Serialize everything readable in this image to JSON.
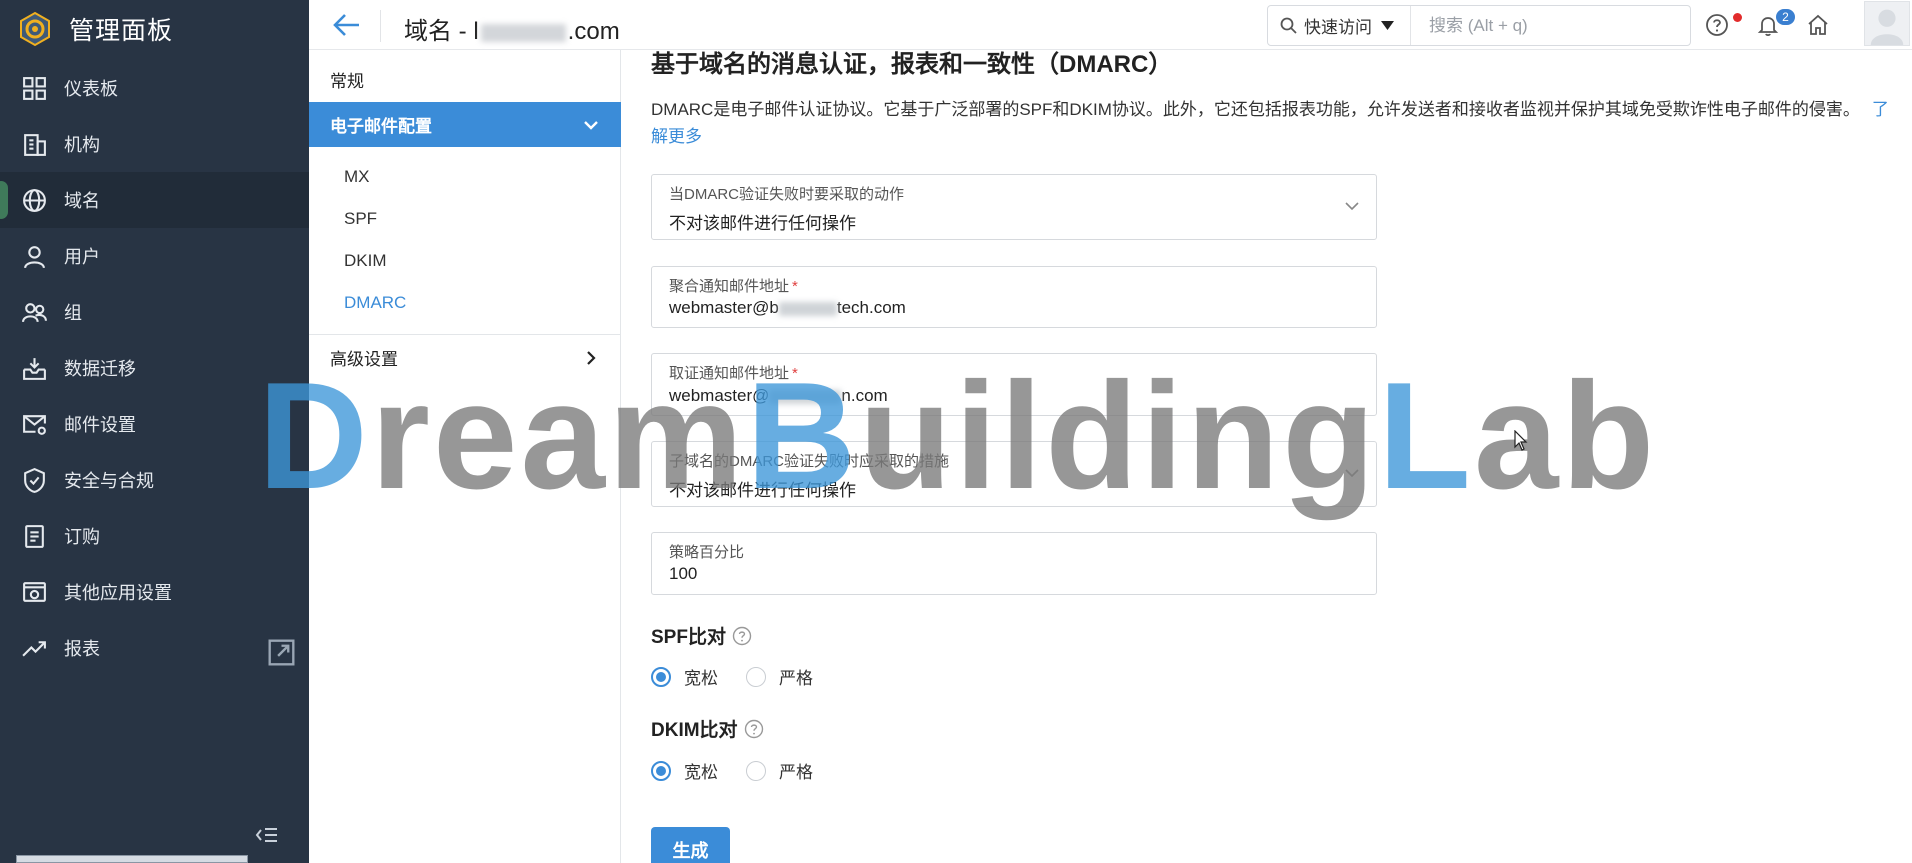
{
  "sidebar": {
    "title": "管理面板",
    "items": [
      {
        "label": "仪表板",
        "icon": "dashboard-icon"
      },
      {
        "label": "机构",
        "icon": "building-icon"
      },
      {
        "label": "域名",
        "icon": "globe-icon",
        "active": true
      },
      {
        "label": "用户",
        "icon": "user-icon"
      },
      {
        "label": "组",
        "icon": "group-icon"
      },
      {
        "label": "数据迁移",
        "icon": "inbox-download-icon"
      },
      {
        "label": "邮件设置",
        "icon": "mail-settings-icon"
      },
      {
        "label": "安全与合规",
        "icon": "shield-icon"
      },
      {
        "label": "订购",
        "icon": "document-icon"
      },
      {
        "label": "其他应用设置",
        "icon": "apps-settings-icon"
      },
      {
        "label": "报表",
        "icon": "trend-icon"
      }
    ]
  },
  "header": {
    "title_prefix": "域名 - ",
    "title_prefix_char": "l",
    "title_suffix": ".com",
    "quick_access": "快速访问",
    "search_placeholder": "搜索 (Alt + q)",
    "notifications_count": "2"
  },
  "submenu": {
    "general": "常规",
    "email_config": "电子邮件配置",
    "children": [
      "MX",
      "SPF",
      "DKIM",
      "DMARC"
    ],
    "advanced": "高级设置"
  },
  "main": {
    "heading": "基于域名的消息认证，报表和一致性（DMARC）",
    "description": "DMARC是电子邮件认证协议。它基于广泛部署的SPF和DKIM协议。此外，它还包括报表功能，允许发送者和接收者监视并保护其域免受欺诈性电子邮件的侵害。",
    "learn_more": "了解更多",
    "fields": {
      "policy_label": "当DMARC验证失败时要采取的动作",
      "policy_value": "不对该邮件进行任何操作",
      "aggregate_label": "聚合通知邮件地址",
      "aggregate_prefix": "webmaster@b",
      "aggregate_suffix": "tech.com",
      "forensic_label": "取证通知邮件地址",
      "forensic_prefix": "webmaster@",
      "forensic_suffix": "n.com",
      "subdomain_label": "子域名的DMARC验证失败时应采取的措施",
      "subdomain_value": "不对该邮件进行任何操作",
      "percent_label": "策略百分比",
      "percent_value": "100"
    },
    "spf": {
      "title": "SPF比对",
      "relaxed": "宽松",
      "strict": "严格",
      "selected": "宽松"
    },
    "dkim": {
      "title": "DKIM比对",
      "relaxed": "宽松",
      "strict": "严格",
      "selected": "宽松"
    },
    "generate": "生成"
  },
  "watermark": {
    "p1": "D",
    "p2": "ream",
    "p3": "B",
    "p4": "uilding",
    "p5": "L",
    "p6": "ab"
  },
  "colors": {
    "sidebar_bg": "#283444",
    "accent": "#3b8cd8",
    "watermark_blue": "#3d97d9"
  }
}
